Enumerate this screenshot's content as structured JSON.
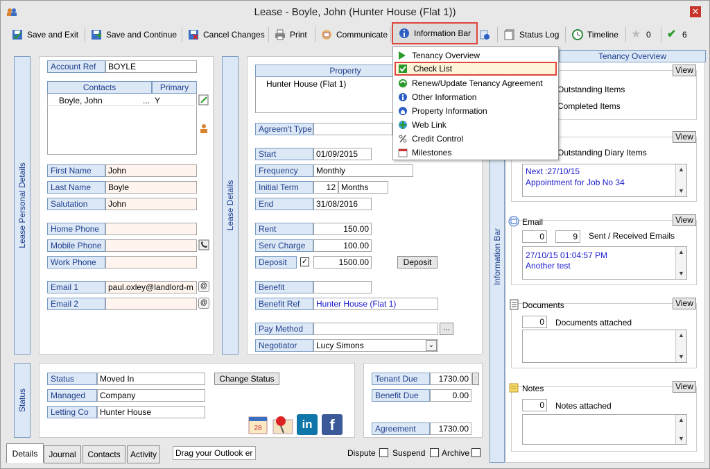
{
  "window": {
    "title": "Lease - Boyle, John (Hunter House (Flat 1))",
    "close": "✕"
  },
  "toolbar": {
    "save_exit": "Save and Exit",
    "save_continue": "Save and Continue",
    "cancel": "Cancel Changes",
    "print": "Print",
    "communicate": "Communicate",
    "information_bar": "Information Bar",
    "status_log": "Status Log",
    "timeline": "Timeline",
    "star_count": "0",
    "check_count": "6"
  },
  "menu": {
    "items": [
      "Tenancy Overview",
      "Check List",
      "Renew/Update Tenancy Agreement",
      "Other Information",
      "Property Information",
      "Web Link",
      "Credit Control",
      "Milestones"
    ]
  },
  "personal": {
    "section_title": "Lease Personal Details",
    "account_ref_label": "Account Ref",
    "account_ref": "BOYLE",
    "contacts_header": "Contacts",
    "primary_header": "Primary",
    "contact_name": "Boyle, John",
    "contact_ellipsis": "...",
    "contact_primary": "Y",
    "first_name_label": "First Name",
    "first_name": "John",
    "last_name_label": "Last Name",
    "last_name": "Boyle",
    "salutation_label": "Salutation",
    "salutation": "John",
    "home_phone_label": "Home Phone",
    "mobile_phone_label": "Mobile Phone",
    "work_phone_label": "Work Phone",
    "email1_label": "Email 1",
    "email1": "paul.oxley@landlord-m",
    "email2_label": "Email 2"
  },
  "lease": {
    "section_title": "Lease Details",
    "property_header": "Property",
    "property": "Hunter House (Flat 1)",
    "agreement_type_label": "Agreem't Type",
    "start_label": "Start",
    "start": "01/09/2015",
    "frequency_label": "Frequency",
    "frequency": "Monthly",
    "initial_term_label": "Initial Term",
    "initial_term": "12",
    "initial_term_unit": "Months",
    "end_label": "End",
    "end": "31/08/2016",
    "rent_label": "Rent",
    "rent": "150.00",
    "serv_charge_label": "Serv Charge",
    "serv_charge": "100.00",
    "deposit_label": "Deposit",
    "deposit": "1500.00",
    "deposit_btn": "Deposit",
    "deposit_checked": "✓",
    "benefit_label": "Benefit",
    "benefit_ref_label": "Benefit Ref",
    "benefit_ref": "Hunter House (Flat 1)",
    "pay_method_label": "Pay Method",
    "pay_method_btn": "...",
    "negotiator_label": "Negotiator",
    "negotiator": "Lucy Simons"
  },
  "status": {
    "section_title": "Status",
    "status_label": "Status",
    "status": "Moved In",
    "change_status": "Change Status",
    "managed_label": "Managed",
    "managed": "Company",
    "letting_co_label": "Letting Co",
    "letting_co": "Hunter House",
    "tenant_due_label": "Tenant Due",
    "tenant_due": "1730.00",
    "benefit_due_label": "Benefit Due",
    "benefit_due": "0.00",
    "agreement_label": "Agreement",
    "agreement": "1730.00",
    "linkedin": "in",
    "facebook": "f"
  },
  "info": {
    "section_title": "Information Bar",
    "header": "Tenancy Overview",
    "view": "View",
    "outstanding_items": "Outstanding Items",
    "completed_items": "Completed Items",
    "outstanding_diary": "Outstanding Diary Items",
    "diary_next": "Next :27/10/15",
    "diary_text": "Appointment for Job No 34",
    "email_label": "Email",
    "email_sent": "0",
    "email_received": "9",
    "email_caption": "Sent / Received Emails",
    "email_date": "27/10/15 01:04:57 PM",
    "email_subject": "Another test",
    "documents_label": "Documents",
    "documents_count": "0",
    "documents_caption": "Documents attached",
    "notes_label": "Notes",
    "notes_count": "0",
    "notes_caption": "Notes attached"
  },
  "bottom": {
    "tabs": [
      "Details",
      "Journal",
      "Contacts",
      "Activity"
    ],
    "outlook": "Drag your Outlook er",
    "dispute": "Dispute",
    "suspend": "Suspend",
    "archive": "Archive"
  }
}
